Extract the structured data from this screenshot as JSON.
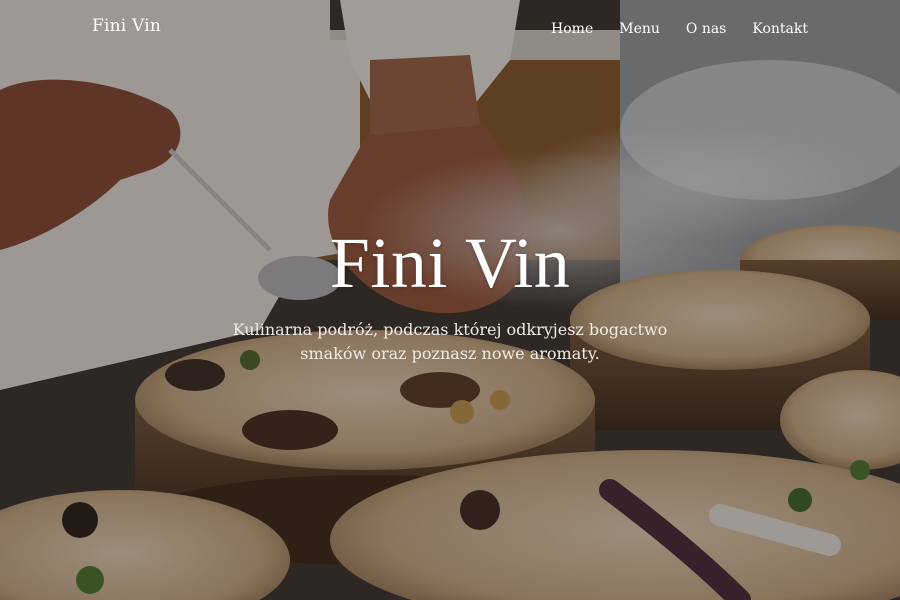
{
  "brand": {
    "name": "Fini Vin"
  },
  "nav": {
    "items": [
      {
        "label": "Home"
      },
      {
        "label": "Menu"
      },
      {
        "label": "O nas"
      },
      {
        "label": "Kontakt"
      }
    ]
  },
  "hero": {
    "title": "Fini Vin",
    "subtitle": "Kulinarna podróż, podczas której odkryjesz bogactwo smaków oraz poznasz nowe aromaty."
  },
  "colors": {
    "overlay": "#191412",
    "text": "#ffffff"
  }
}
